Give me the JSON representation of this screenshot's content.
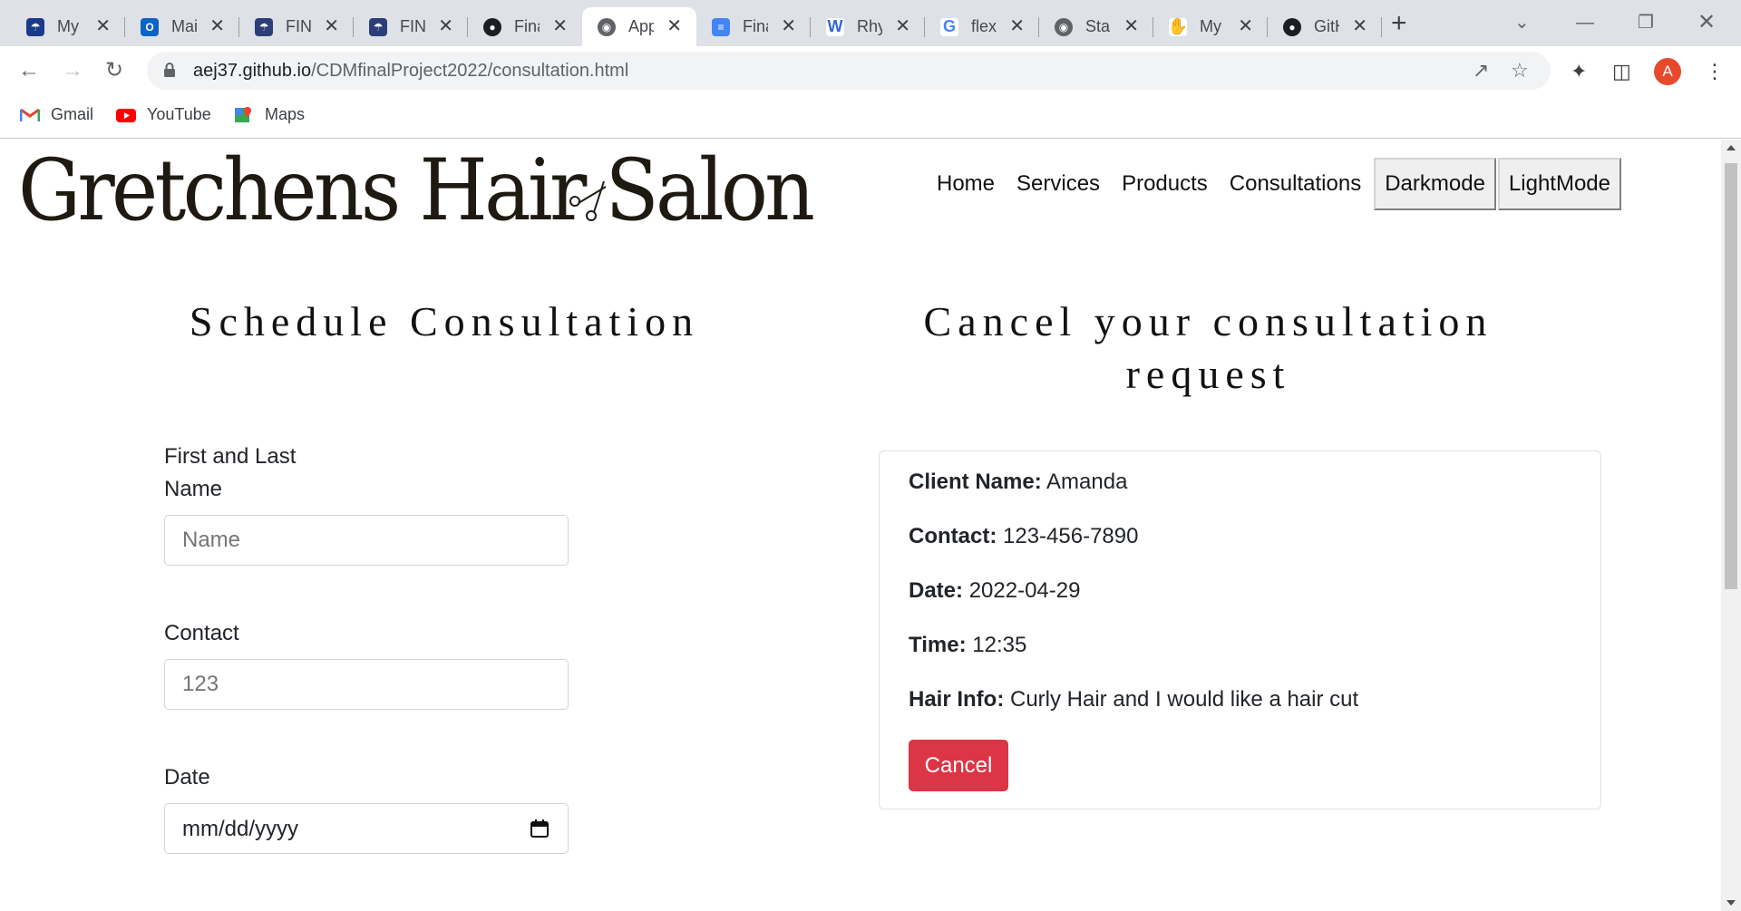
{
  "browser": {
    "tabs": [
      {
        "title": "My",
        "icon": "shield-crest-icon",
        "color": "#1a3a8a"
      },
      {
        "title": "Mai",
        "icon": "outlook-icon",
        "color": "#0a64c8"
      },
      {
        "title": "FIN",
        "icon": "shield-crest-icon",
        "color": "#2c3e7a"
      },
      {
        "title": "FIN",
        "icon": "shield-crest-icon",
        "color": "#2c3e7a"
      },
      {
        "title": "Fina",
        "icon": "github-icon",
        "color": "#1b1f23"
      },
      {
        "title": "App",
        "icon": "globe-icon",
        "color": "#5f6368"
      },
      {
        "title": "Fina",
        "icon": "docs-icon",
        "color": "#4285f4"
      },
      {
        "title": "Rhy",
        "icon": "w-icon",
        "color": "#3367d6"
      },
      {
        "title": "flex",
        "icon": "google-icon",
        "color": "#4285f4"
      },
      {
        "title": "Star",
        "icon": "globe-icon",
        "color": "#5f6368"
      },
      {
        "title": "My",
        "icon": "hand-icon",
        "color": "#f4b400"
      },
      {
        "title": "GitH",
        "icon": "github-icon",
        "color": "#1b1f23"
      }
    ],
    "url_host": "aej37.github.io",
    "url_path": "/CDMfinalProject2022/consultation.html",
    "profile_initial": "A",
    "bookmarks": [
      "Gmail",
      "YouTube",
      "Maps"
    ]
  },
  "site": {
    "logo_text": "Gretchens Hair Salon",
    "nav": [
      "Home",
      "Services",
      "Products",
      "Consultations"
    ],
    "darkmode_label": "Darkmode",
    "lightmode_label": "LightMode"
  },
  "schedule": {
    "title": "Schedule Consultation",
    "name_label": "First and Last Name",
    "name_placeholder": "Name",
    "contact_label": "Contact",
    "contact_placeholder": "123",
    "date_label": "Date",
    "date_placeholder": "mm/dd/yyyy"
  },
  "cancel": {
    "title": "Cancel your consultation request",
    "client_name_label": "Client Name:",
    "client_name": "Amanda",
    "contact_label": "Contact:",
    "contact": "123-456-7890",
    "date_label": "Date:",
    "date": "2022-04-29",
    "time_label": "Time:",
    "time": "12:35",
    "hair_info_label": "Hair Info:",
    "hair_info": "Curly Hair and I would like a hair cut",
    "cancel_button": "Cancel",
    "accent_color": "#dc3545"
  }
}
